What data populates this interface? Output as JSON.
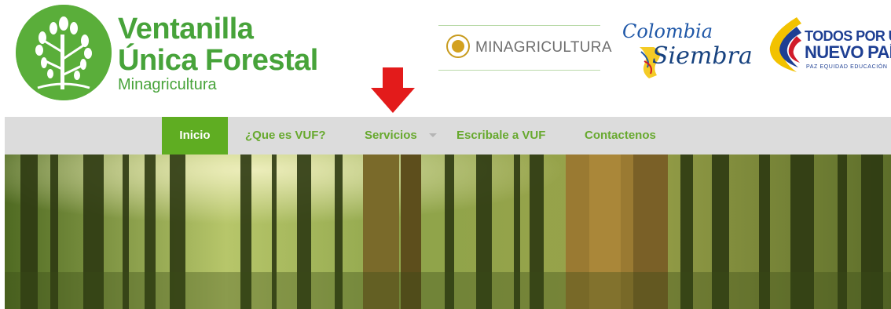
{
  "brand": {
    "line1": "Ventanilla",
    "line2": "Única Forestal",
    "line3": "Minagricultura"
  },
  "partner_minag": "MINAGRICULTURA",
  "partner_colombia": {
    "line1": "Colombia",
    "line2": "Siembra"
  },
  "partner_todos": {
    "line1": "TODOS POR UN",
    "line2": "NUEVO PAÍS",
    "tagline": "PAZ  EQUIDAD  EDUCACIÓN"
  },
  "nav": {
    "items": [
      "Inicio",
      "¿Que es VUF?",
      "Servicios",
      "Escribale a VUF",
      "Contactenos"
    ],
    "active_index": 0
  },
  "colors": {
    "brand_green": "#47a33a",
    "nav_active": "#5fad22",
    "nav_text": "#67a92e",
    "nav_bar": "#dcdcdc",
    "arrow": "#e31b1b"
  },
  "icons": [
    "tree-logo-icon",
    "down-arrow-indicator-icon",
    "dropdown-caret-icon",
    "seal-icon"
  ]
}
